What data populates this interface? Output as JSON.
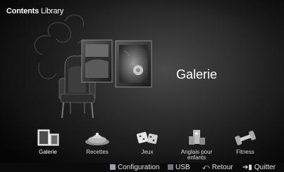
{
  "header": {
    "title_bold": "Contents",
    "title_regular": "Library"
  },
  "featured": {
    "title": "Galerie"
  },
  "apps": [
    {
      "label": "Galerie",
      "icon": "gallery-icon",
      "selected": true
    },
    {
      "label": "Recettes",
      "icon": "recipes-icon",
      "selected": false
    },
    {
      "label": "Jeux",
      "icon": "dice-icon",
      "selected": false
    },
    {
      "label_line1": "Anglais pour",
      "label_line2": "enfants",
      "icon": "kids-english-icon",
      "selected": false
    },
    {
      "label": "Fitness",
      "icon": "dumbbell-icon",
      "selected": false
    }
  ],
  "bottom_bar": {
    "configuration": "Configuration",
    "usb": "USB",
    "return": "Retour",
    "exit": "Quitter",
    "configuration_color": "#9aa1ad",
    "usb_color": "#6f7580"
  }
}
